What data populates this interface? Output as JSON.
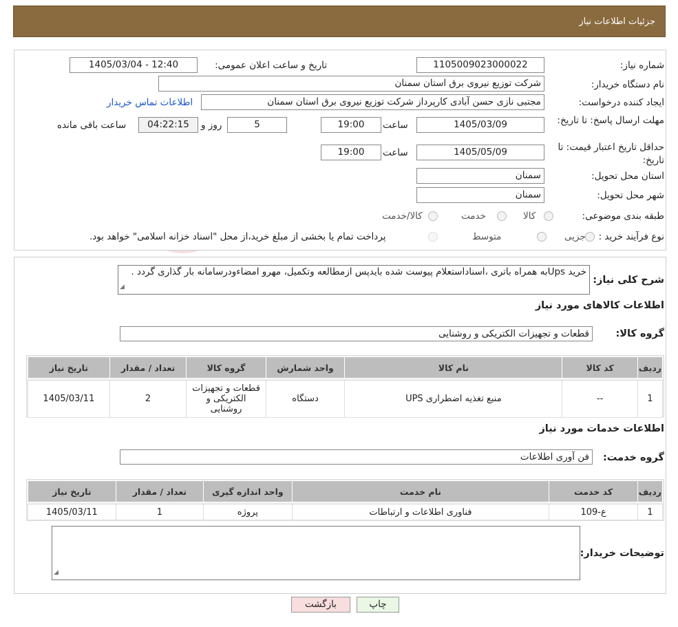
{
  "header": {
    "title": "جزئیات اطلاعات نیاز"
  },
  "form": {
    "need_number_label": "شماره نیاز:",
    "need_number": "1105009023000022",
    "announce_label": "تاریخ و ساعت اعلان عمومی:",
    "announce_value": "1405/03/04 - 12:40",
    "buyer_org_label": "نام دستگاه خریدار:",
    "buyer_org": "شرکت توزیع نیروی برق استان سمنان",
    "creator_label": "ایجاد کننده درخواست:",
    "creator": "مجتبی نازی حسن آبادی کارپرداز شرکت توزیع نیروی برق استان سمنان",
    "contact_link": "اطلاعات تماس خریدار",
    "deadline_label": "مهلت ارسال پاسخ: تا تاریخ:",
    "deadline_date": "1405/03/09",
    "time_label": "ساعت",
    "deadline_time": "19:00",
    "days_value": "5",
    "days_label": "روز و",
    "remaining_time": "04:22:15",
    "remaining_label": "ساعت باقی مانده",
    "validity_label": "حداقل تاریخ اعتبار قیمت: تا تاریخ:",
    "validity_date": "1405/05/09",
    "validity_time": "19:00",
    "province_label": "استان محل تحویل:",
    "province": "سمنان",
    "city_label": "شهر محل تحویل:",
    "city": "سمنان",
    "category_label": "طبقه بندی موضوعی:",
    "category_options": [
      "کالا",
      "خدمت",
      "کالا/خدمت"
    ],
    "process_label": "نوع فرآیند خرید :",
    "process_options": [
      "جزیی",
      "متوسط"
    ],
    "process_note": "پرداخت تمام یا بخشی از مبلغ خرید،از محل \"اسناد خزانه اسلامی\" خواهد بود."
  },
  "description": {
    "label": "شرح کلی نیاز:",
    "text": "خرید Upsبه همراه باتری ،اسناداستعلام پیوست شده بایدپس ازمطالعه وتکمیل، مهرو امضاءودرسامانه بار گذاری گردد ."
  },
  "goods": {
    "section_title": "اطلاعات کالاهای مورد نیاز",
    "group_label": "گروه کالا:",
    "group_value": "قطعات و تجهیزات الکتریکی و روشنایی",
    "columns": [
      "ردیف",
      "کد کالا",
      "نام کالا",
      "واحد شمارش",
      "گروه کالا",
      "تعداد / مقدار",
      "تاریخ نیاز"
    ],
    "rows": [
      [
        "1",
        "--",
        "منبع تغذیه اضطراری UPS",
        "دستگاه",
        "قطعات و تجهیزات الکتریکی و روشنایی",
        "2",
        "1405/03/11"
      ]
    ]
  },
  "services": {
    "section_title": "اطلاعات خدمات مورد نیاز",
    "group_label": "گروه خدمت:",
    "group_value": "فن آوری اطلاعات",
    "columns": [
      "ردیف",
      "کد خدمت",
      "نام خدمت",
      "واحد اندازه گیری",
      "تعداد / مقدار",
      "تاریخ نیاز"
    ],
    "rows": [
      [
        "1",
        "ع-109",
        "فناوری اطلاعات و ارتباطات",
        "پروژه",
        "1",
        "1405/03/11"
      ]
    ]
  },
  "buyer_notes": {
    "label": "توضیحات خریدار:",
    "text": ""
  },
  "buttons": {
    "print": "چاپ",
    "back": "بازگشت"
  },
  "colors": {
    "header_bg": "#8a6a3f",
    "print_btn": "#e9f7e4",
    "back_btn": "#f8dede",
    "link": "#1a55c8"
  }
}
